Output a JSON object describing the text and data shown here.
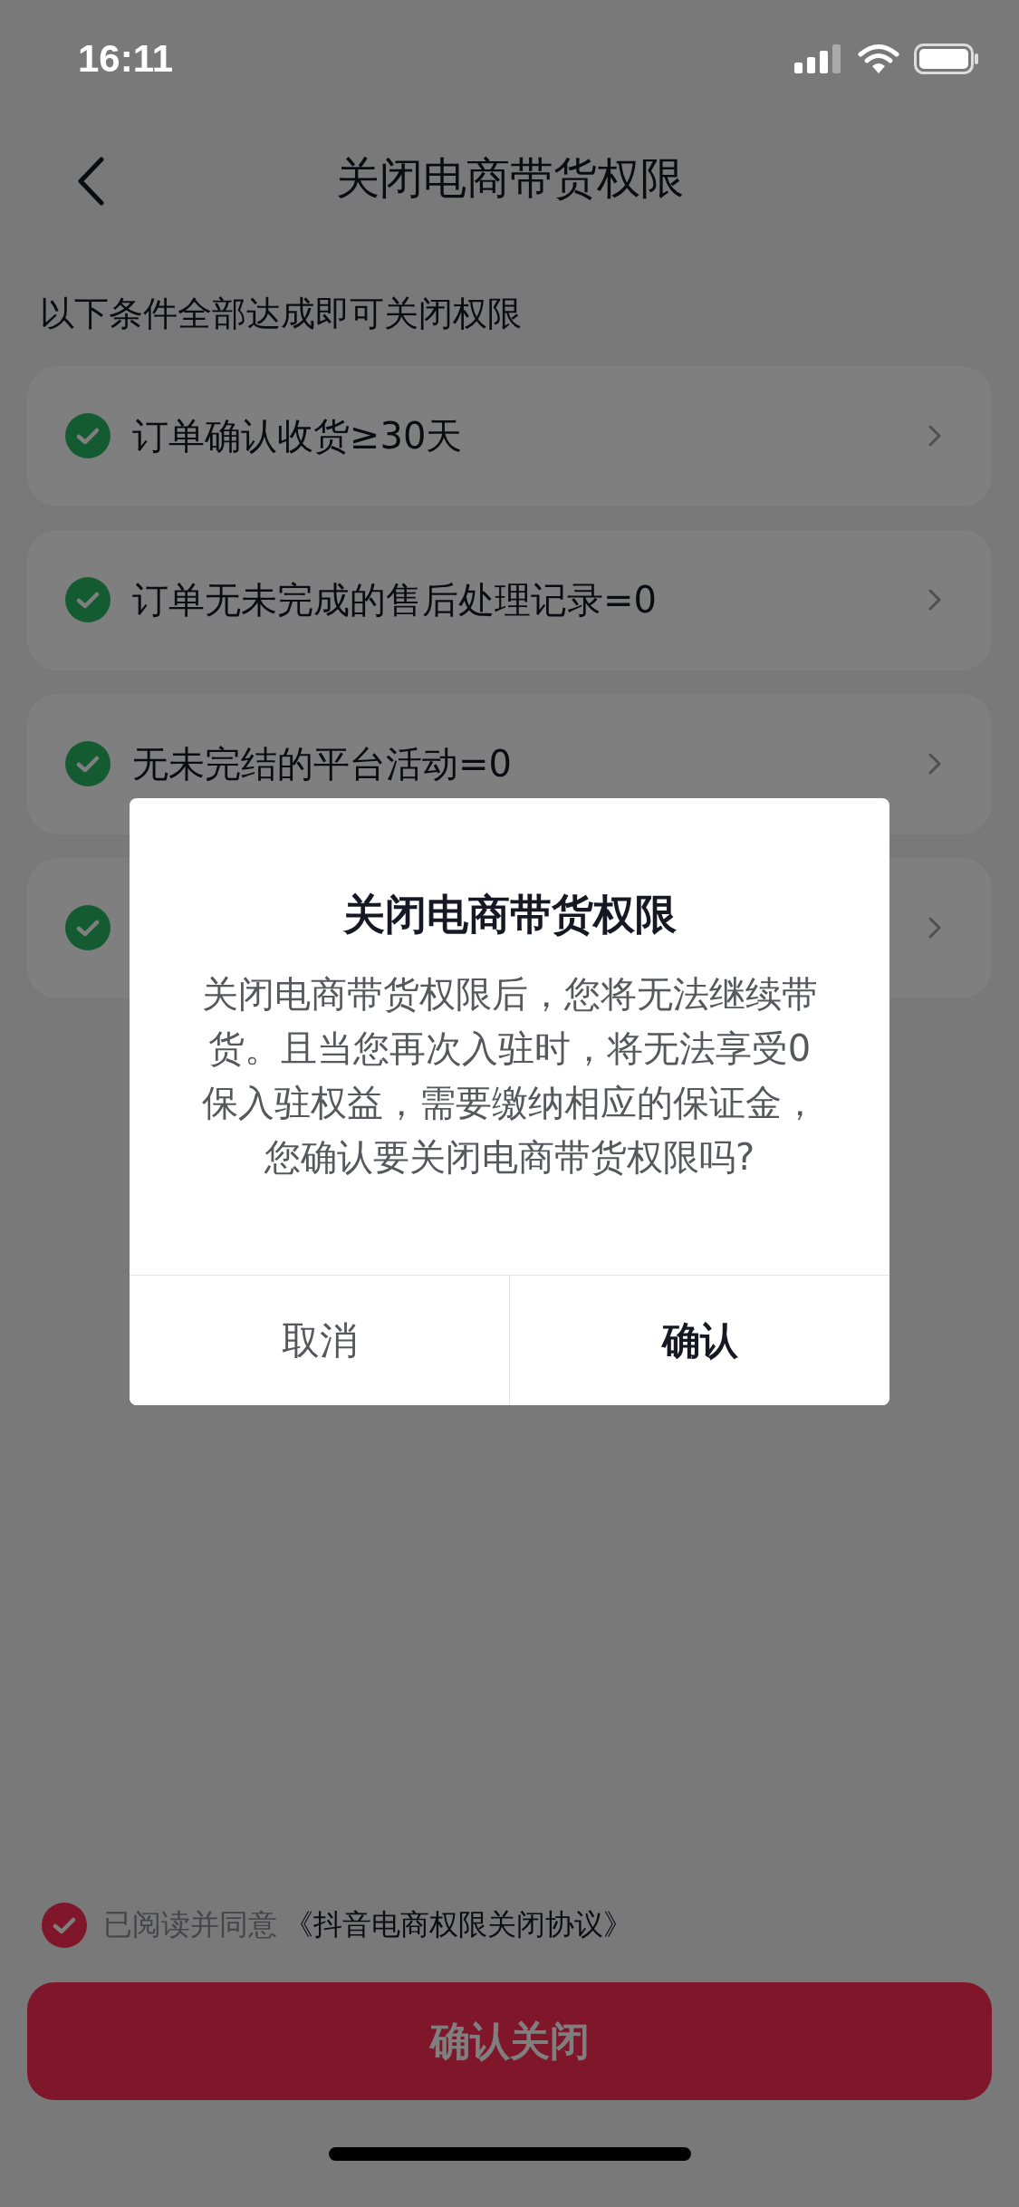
{
  "status_bar": {
    "time": "16:11"
  },
  "nav": {
    "title": "关闭电商带货权限"
  },
  "section_heading": "以下条件全部达成即可关闭权限",
  "conditions": [
    {
      "label": "订单确认收货≥30天",
      "met": true
    },
    {
      "label": "订单无未完成的售后处理记录=0",
      "met": true
    },
    {
      "label": "无未完结的平台活动=0",
      "met": true
    },
    {
      "met": true
    }
  ],
  "agreement": {
    "checked": true,
    "text": "已阅读并同意",
    "link": "《抖音电商权限关闭协议》"
  },
  "primary_button": "确认关闭",
  "dialog": {
    "title": "关闭电商带货权限",
    "message": "关闭电商带货权限后，您将无法继续带货。且当您再次入驻时，将无法享受0保入驻权益，需要缴纳相应的保证金，您确认要关闭电商带货权限吗?",
    "buttons": [
      {
        "label": "取消",
        "kind": "secondary"
      },
      {
        "label": "确认",
        "kind": "primary"
      }
    ]
  }
}
